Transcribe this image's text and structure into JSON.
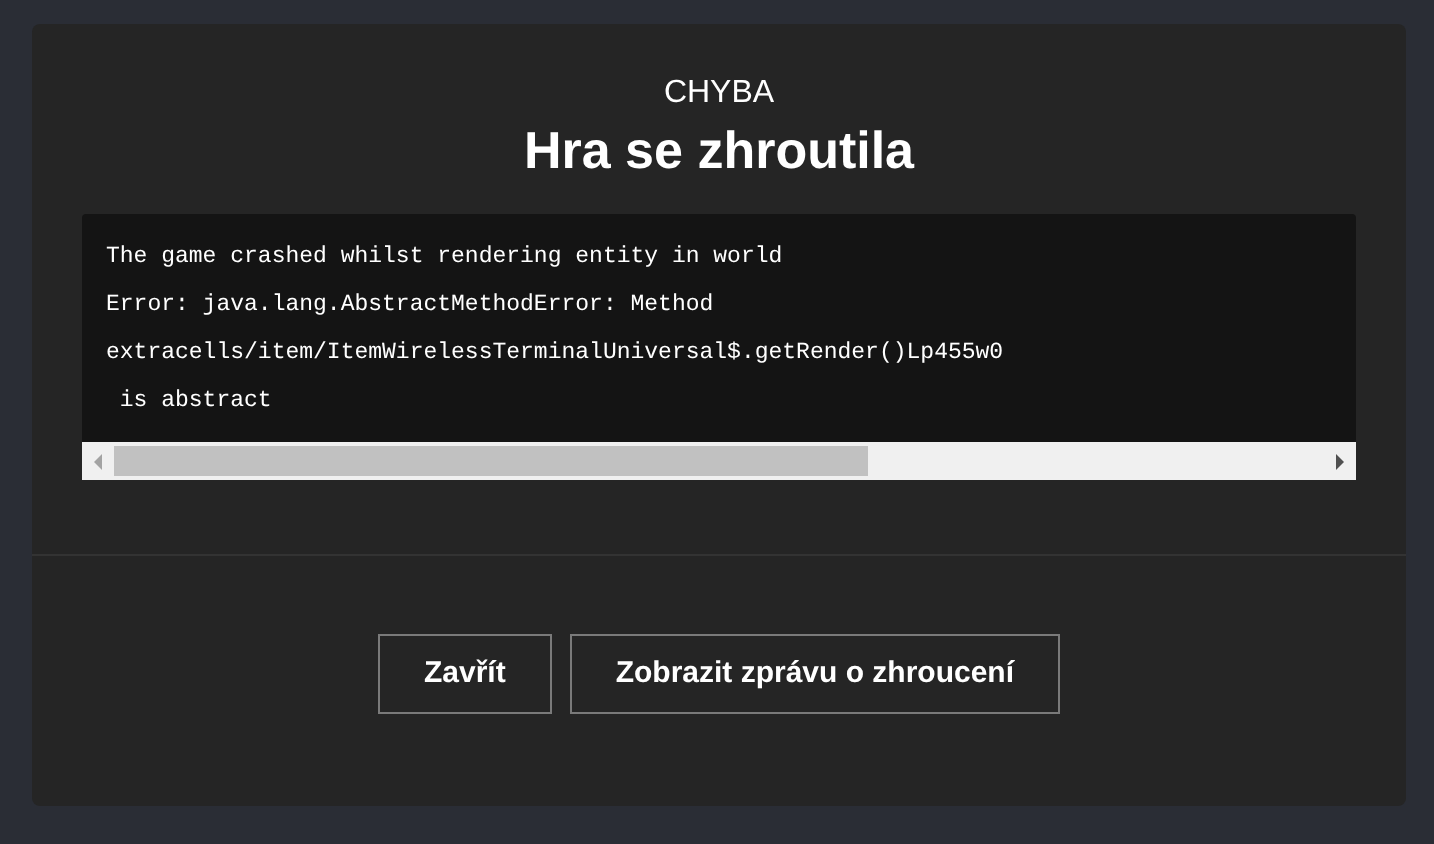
{
  "dialog": {
    "label": "CHYBA",
    "title": "Hra se zhroutila",
    "log_lines": [
      "The game crashed whilst rendering entity in world",
      "Error: java.lang.AbstractMethodError: Method",
      "extracells/item/ItemWirelessTerminalUniversal$.getRender()Lp455w0",
      " is abstract"
    ],
    "buttons": [
      "Zavřít",
      "Zobrazit zprávu o zhroucení"
    ]
  }
}
